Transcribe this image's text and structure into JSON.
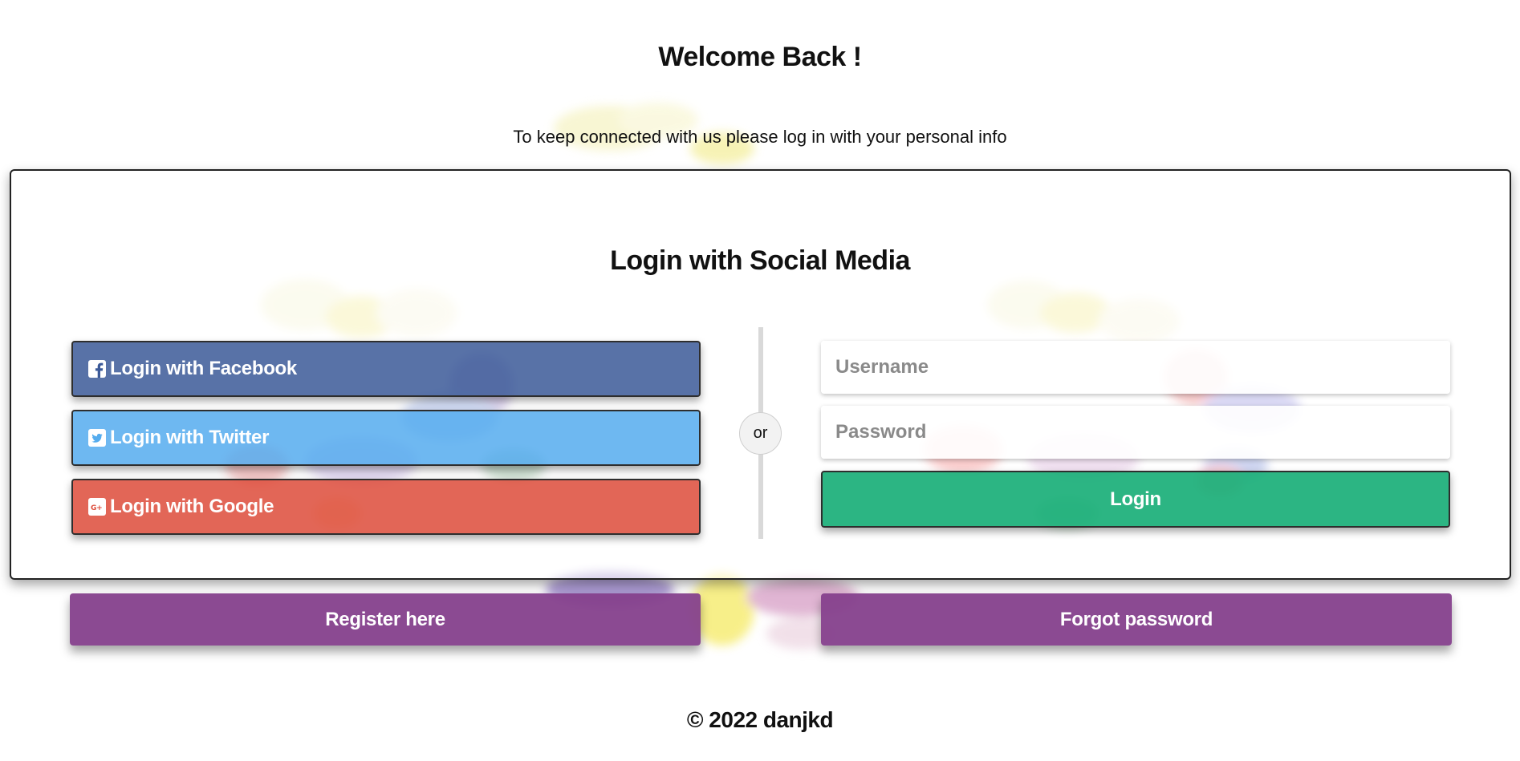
{
  "header": {
    "title": "Welcome Back !",
    "subtitle": "To keep connected with us please log in with your personal info"
  },
  "card": {
    "title": "Login with Social Media",
    "divider_label": "or",
    "social_buttons": [
      {
        "label": "Login with Facebook",
        "icon": "facebook-icon",
        "color": "#3b5998"
      },
      {
        "label": "Login with Twitter",
        "icon": "twitter-icon",
        "color": "#55acee"
      },
      {
        "label": "Login with Google",
        "icon": "google-plus-icon",
        "color": "#dd4b39"
      }
    ],
    "form": {
      "username_placeholder": "Username",
      "username_value": "",
      "password_placeholder": "Password",
      "password_value": "",
      "login_label": "Login",
      "login_color": "#1aaf78"
    }
  },
  "actions": {
    "register_label": "Register here",
    "forgot_label": "Forgot password",
    "color": "#85408c"
  },
  "footer": {
    "text": "© 2022 danjkd"
  }
}
